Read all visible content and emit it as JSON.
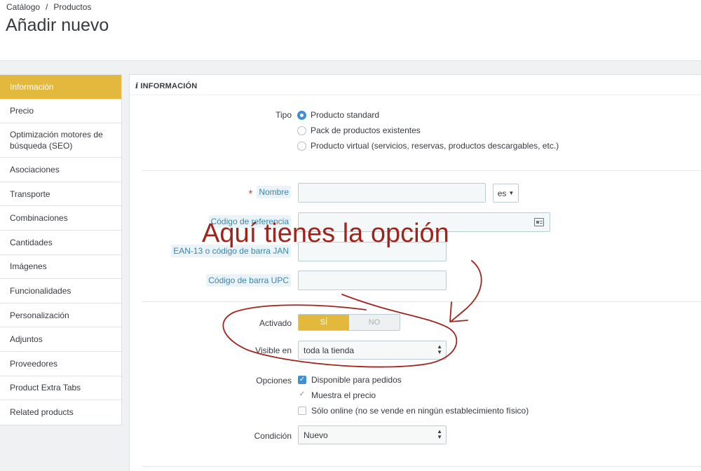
{
  "breadcrumb": {
    "parent": "Catálogo",
    "separator": "/",
    "current": "Productos"
  },
  "page": {
    "title": "Añadir nuevo"
  },
  "sidebar": {
    "items": [
      {
        "label": "Información",
        "active": true
      },
      {
        "label": "Precio"
      },
      {
        "label": "Optimización motores de búsqueda (SEO)"
      },
      {
        "label": "Asociaciones"
      },
      {
        "label": "Transporte"
      },
      {
        "label": "Combinaciones"
      },
      {
        "label": "Cantidades"
      },
      {
        "label": "Imágenes"
      },
      {
        "label": "Funcionalidades"
      },
      {
        "label": "Personalización"
      },
      {
        "label": "Adjuntos"
      },
      {
        "label": "Proveedores"
      },
      {
        "label": "Product Extra Tabs"
      },
      {
        "label": "Related products"
      }
    ]
  },
  "panel": {
    "heading": "INFORMACIÓN",
    "heading_icon": "info-icon",
    "tipo": {
      "label": "Tipo",
      "options": [
        "Producto standard",
        "Pack de productos existentes",
        "Producto virtual (servicios, reservas, productos descargables, etc.)"
      ],
      "selected": "Producto standard"
    },
    "nombre": {
      "required_mark": "*",
      "label": "Nombre",
      "value": "",
      "lang": "es"
    },
    "referencia": {
      "label": "Código de referencia",
      "value": ""
    },
    "ean": {
      "label": "EAN-13 o código de barra JAN",
      "value": ""
    },
    "upc": {
      "label": "Código de barra UPC",
      "value": ""
    },
    "activado": {
      "label": "Activado",
      "yes": "SÍ",
      "no": "NO",
      "value": "SÍ"
    },
    "visible": {
      "label": "Visible en",
      "value": "toda la tienda"
    },
    "opciones": {
      "label": "Opciones",
      "items": [
        {
          "label": "Disponible para pedidos",
          "checked": true
        },
        {
          "label": "Muestra el precio",
          "checked": true
        },
        {
          "label": "Sólo online (no se vende en ningún establecimiento físico)",
          "checked": false
        }
      ]
    },
    "condicion": {
      "label": "Condición",
      "value": "Nuevo"
    }
  },
  "annotation": {
    "text": "Aquí tienes la opción",
    "color": "#a0241c"
  },
  "colors": {
    "accent": "#e2b83d",
    "radio": "#3e8fd6",
    "link_label": "#3c84a6"
  }
}
